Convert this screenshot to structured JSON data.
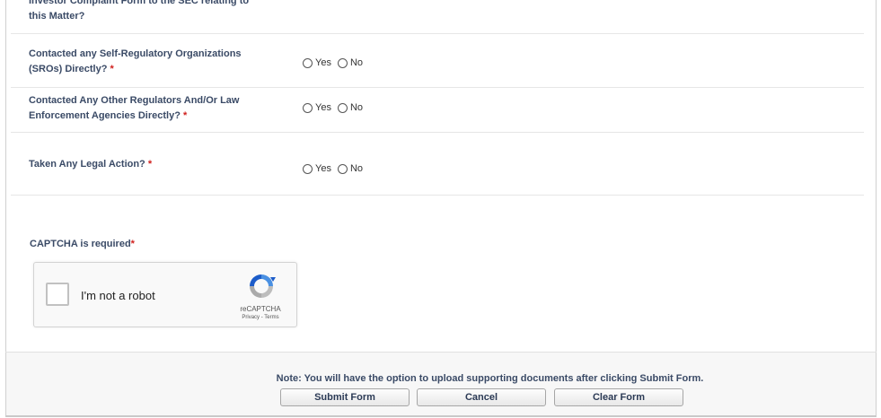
{
  "questions": [
    {
      "label": "Investor Complaint Form to the SEC relating to this Matter?",
      "required": false,
      "options": []
    },
    {
      "label": "Contacted any Self-Regulatory Organizations (SROs) Directly?",
      "required": true,
      "options": [
        "Yes",
        "No"
      ]
    },
    {
      "label": "Contacted Any Other Regulators And/Or Law Enforcement Agencies Directly?",
      "required": true,
      "options": [
        "Yes",
        "No"
      ]
    },
    {
      "label": "Taken Any Legal Action?",
      "required": true,
      "options": [
        "Yes",
        "No"
      ]
    }
  ],
  "required_marker": "*",
  "captcha": {
    "title": "CAPTCHA is required",
    "checkbox_label": "I'm not a robot",
    "brand": "reCAPTCHA",
    "links": "Privacy - Terms"
  },
  "footer": {
    "note": "Note: You will have the option to upload supporting documents after clicking Submit Form.",
    "submit_label": "Submit Form",
    "cancel_label": "Cancel",
    "clear_label": "Clear Form"
  }
}
